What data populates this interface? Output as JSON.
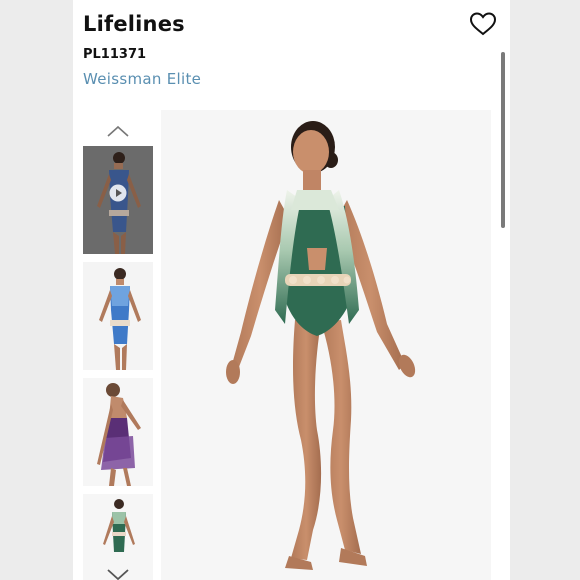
{
  "product": {
    "title": "Lifelines",
    "sku": "PL11371",
    "brand": "Weissman Elite"
  },
  "icons": {
    "favorite": "heart-outline-icon",
    "prev": "chevron-up-icon",
    "next": "chevron-down-icon",
    "play": "play-icon"
  },
  "gallery": {
    "thumbnails": [
      {
        "variant": "blue-ombre-video",
        "color": "#3a5f9e"
      },
      {
        "variant": "blue-ombre",
        "color": "#3f6fb8"
      },
      {
        "variant": "purple-ombre-back",
        "color": "#6a3f86"
      },
      {
        "variant": "green-ombre",
        "color": "#3a6a4e"
      }
    ],
    "main_variant": "green-ombre"
  },
  "colors": {
    "brand_link": "#5a8fb1",
    "text": "#111111",
    "bodice_green": "#2f6b52"
  }
}
